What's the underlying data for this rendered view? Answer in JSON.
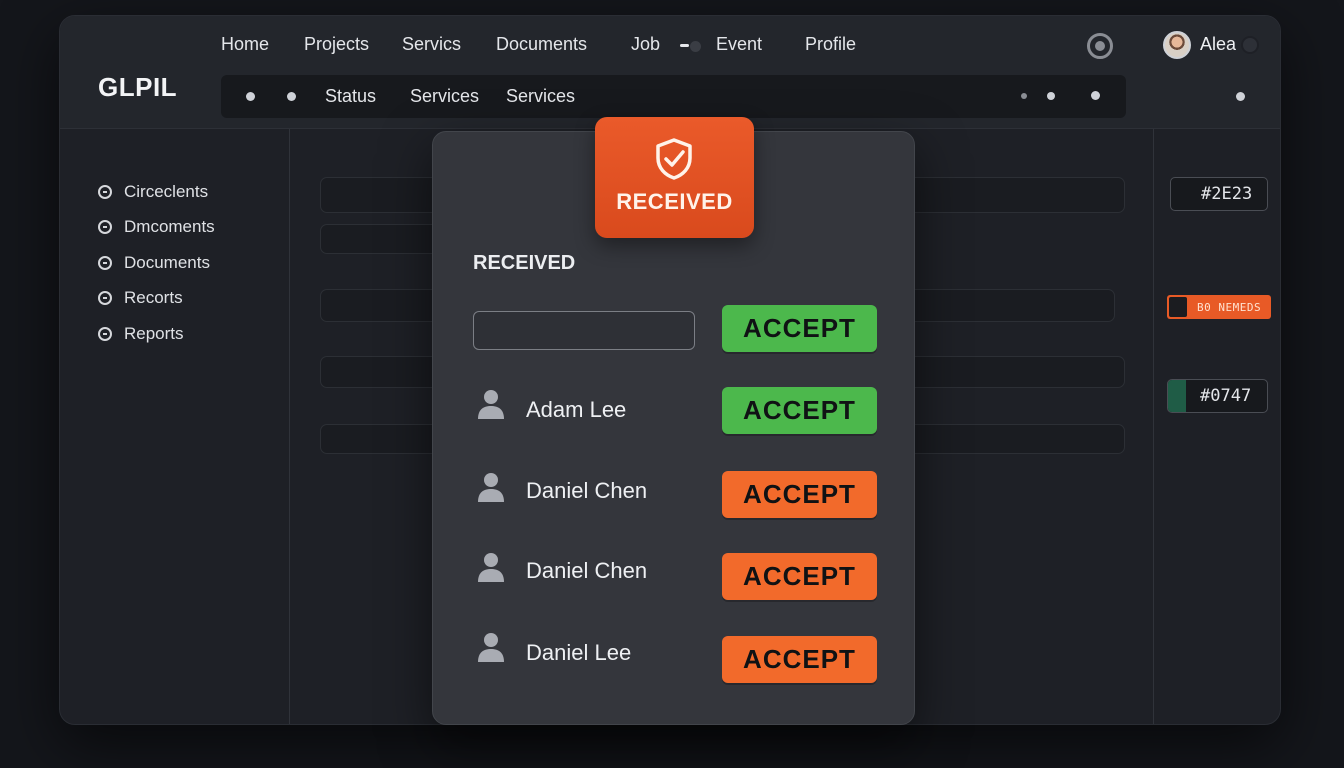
{
  "app": {
    "logo": "GLPIL",
    "user_name": "Alea"
  },
  "nav": {
    "items": [
      {
        "label": "Home"
      },
      {
        "label": "Projects"
      },
      {
        "label": "Servics"
      },
      {
        "label": "Documents"
      },
      {
        "label": "Job"
      },
      {
        "label": "Event"
      },
      {
        "label": "Profile"
      }
    ]
  },
  "subnav": {
    "items": [
      {
        "label": "Status"
      },
      {
        "label": "Services"
      },
      {
        "label": "Services"
      }
    ]
  },
  "sidebar": {
    "items": [
      {
        "label": "Circeclents"
      },
      {
        "label": "Dmcoments"
      },
      {
        "label": "Documents"
      },
      {
        "label": "Recorts"
      },
      {
        "label": "Reports"
      }
    ]
  },
  "right_panel": {
    "chip1": "#2E23",
    "chip2": "B0 NEMEDS",
    "chip3": "#0747"
  },
  "modal": {
    "badge_label": "RECEIVED",
    "title": "RECEIVED",
    "input_value": "",
    "top_button": "ACCEPT",
    "rows": [
      {
        "name": "Adam Lee",
        "button": "ACCEPT",
        "color": "#4cb84c"
      },
      {
        "name": "Daniel Chen",
        "button": "ACCEPT",
        "color": "#f26a2b"
      },
      {
        "name": "Daniel Chen",
        "button": "ACCEPT",
        "color": "#f26a2b"
      },
      {
        "name": "Daniel Lee",
        "button": "ACCEPT",
        "color": "#f26a2b"
      }
    ]
  },
  "colors": {
    "accent_orange": "#ea5a2a",
    "accept_green": "#4cb84c",
    "accept_orange": "#f26a2b"
  }
}
